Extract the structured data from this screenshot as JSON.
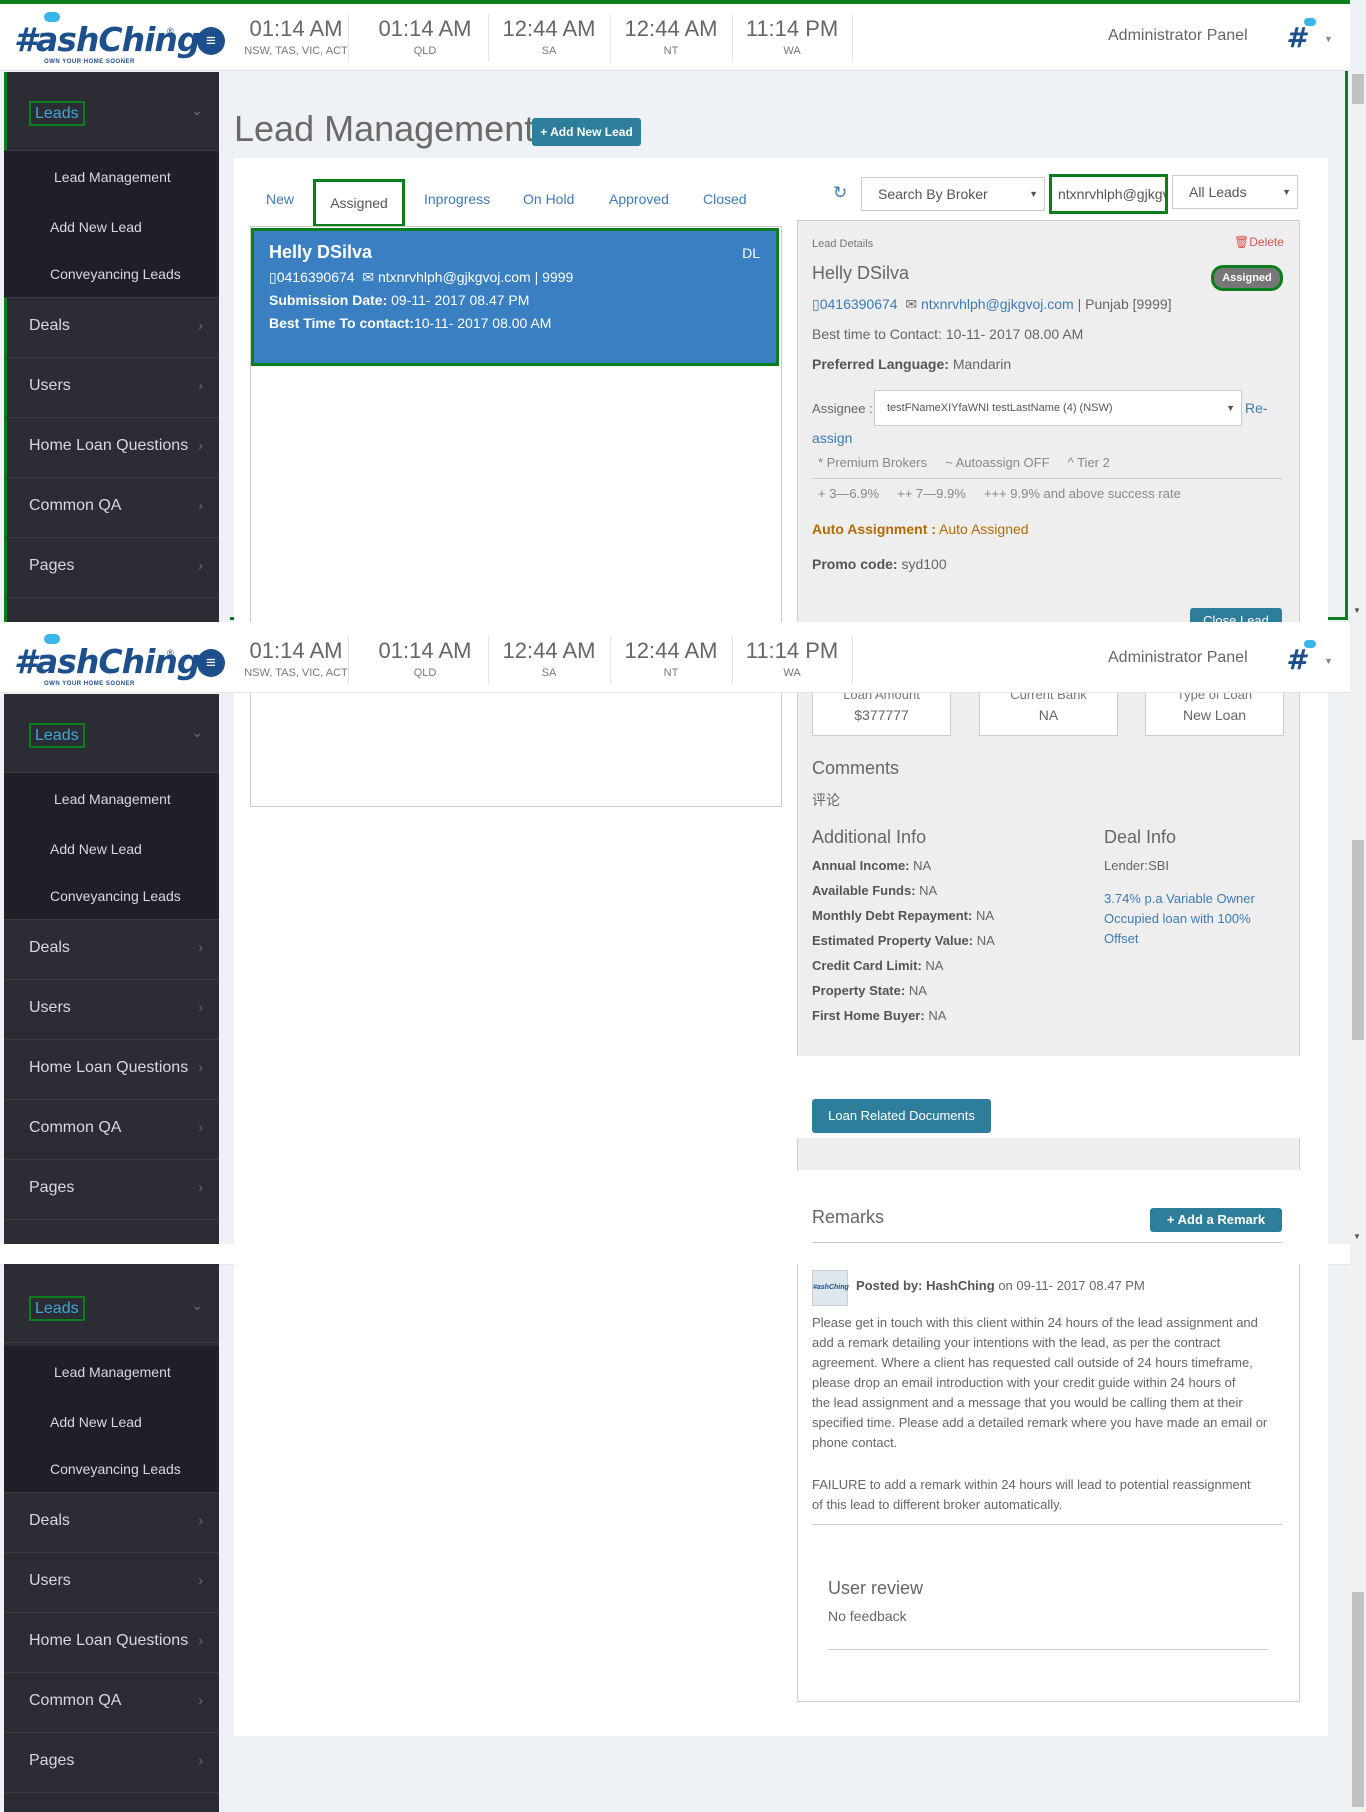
{
  "header": {
    "logo_text": "#ashChing",
    "logo_tagline": "OWN YOUR HOME SOONER",
    "clocks": [
      {
        "time": "01:14 AM",
        "zone": "NSW, TAS, VIC, ACT"
      },
      {
        "time": "01:14 AM",
        "zone": "QLD"
      },
      {
        "time": "12:44 AM",
        "zone": "SA"
      },
      {
        "time": "12:44 AM",
        "zone": "NT"
      },
      {
        "time": "11:14 PM",
        "zone": "WA"
      }
    ],
    "panel_label": "Administrator Panel"
  },
  "sidebar": {
    "leads": "Leads",
    "lead_management": "Lead Management",
    "add_new_lead": "Add New Lead",
    "conveyancing": "Conveyancing Leads",
    "deals": "Deals",
    "users": "Users",
    "home_loan_questions": "Home Loan Questions",
    "common_qa": "Common QA",
    "pages": "Pages"
  },
  "page": {
    "title": "Lead Management",
    "add_new_lead_btn": "+ Add New Lead"
  },
  "tabs": {
    "new": "New",
    "assigned": "Assigned",
    "inprogress": "Inprogress",
    "on_hold": "On Hold",
    "approved": "Approved",
    "closed": "Closed"
  },
  "filters": {
    "broker": "Search By Broker",
    "search_value": "ntxnrvhlph@gjkgvoj.com",
    "leads_filter": "All Leads"
  },
  "lead_card": {
    "name": "Helly DSilva",
    "badge": "DL",
    "phone": "0416390674",
    "email": "ntxnrvhlph@gjkgvoj.com",
    "postcode": "| 9999",
    "submission_label": "Submission Date:",
    "submission_value": "09-11- 2017 08.47 PM",
    "best_time_label": "Best Time To contact:",
    "best_time_value": "10-11- 2017 08.00 AM"
  },
  "detail": {
    "section_label": "Lead Details",
    "delete": "Delete",
    "name": "Helly DSilva",
    "status": "Assigned",
    "phone": "0416390674",
    "email": "ntxnrvhlph@gjkgvoj.com",
    "location": "| Punjab [9999]",
    "best_time": "Best time to Contact: 10-11- 2017 08.00 AM",
    "pref_lang_label": "Preferred Language:",
    "pref_lang_value": "Mandarin",
    "assignee_label": "Assignee :",
    "assignee_value": "testFNameXIYfaWNI testLastName (4) (NSW)",
    "reassign_1": "Re-",
    "reassign_2": "assign",
    "legend_1": "* Premium Brokers",
    "legend_2": "~ Autoassign OFF",
    "legend_3": "^ Tier 2",
    "rate_1": "+ 3—6.9%",
    "rate_2": "++ 7—9.9%",
    "rate_3": "+++ 9.9% and above success rate",
    "auto_label": "Auto Assignment :",
    "auto_value": "Auto Assigned",
    "promo_label": "Promo code:",
    "promo_value": "syd100",
    "close_lead": "Close Lead",
    "loan_amount_label": "Loan Amount",
    "loan_amount": "$377777",
    "current_bank_label": "Current Bank",
    "current_bank": "NA",
    "loan_type_label": "Type of Loan",
    "loan_type": "New Loan",
    "comments_title": "Comments",
    "comments_value": "评论",
    "additional_title": "Additional Info",
    "deal_title": "Deal Info",
    "additional": [
      {
        "label": "Annual Income:",
        "value": "NA"
      },
      {
        "label": "Available Funds:",
        "value": "NA"
      },
      {
        "label": "Monthly Debt Repayment:",
        "value": "NA"
      },
      {
        "label": "Estimated Property Value:",
        "value": "NA"
      },
      {
        "label": "Credit Card Limit:",
        "value": "NA"
      },
      {
        "label": "Property State:",
        "value": "NA"
      },
      {
        "label": "First Home Buyer:",
        "value": "NA"
      }
    ],
    "lender": "Lender:SBI",
    "deal_link_1": "3.74% p.a Variable Owner",
    "deal_link_2": "Occupied loan with 100%",
    "deal_link_3": "Offset",
    "loan_docs_btn": "Loan Related Documents",
    "remarks_title": "Remarks",
    "add_remark_btn": "+ Add a Remark",
    "remark_posted_by": "Posted by: HashChing",
    "remark_date": "on 09-11- 2017 08.47 PM",
    "remark_lines": [
      "Please get in touch with this client within 24 hours of the lead assignment and",
      "add a remark detailing your intentions with the lead, as per the contract",
      "agreement. Where a client has requested call outside of 24 hours timeframe,",
      "please drop an email introduction with your credit guide within 24 hours of",
      "the lead assignment and a message that you would be calling them at their",
      "specified time. Please add a detailed remark where you have made an email or",
      "phone contact."
    ],
    "remark_failure_1": "FAILURE to add a remark within 24 hours will lead to potential reassignment",
    "remark_failure_2": "of this lead to different broker automatically.",
    "review_title": "User review",
    "review_value": "No feedback"
  }
}
